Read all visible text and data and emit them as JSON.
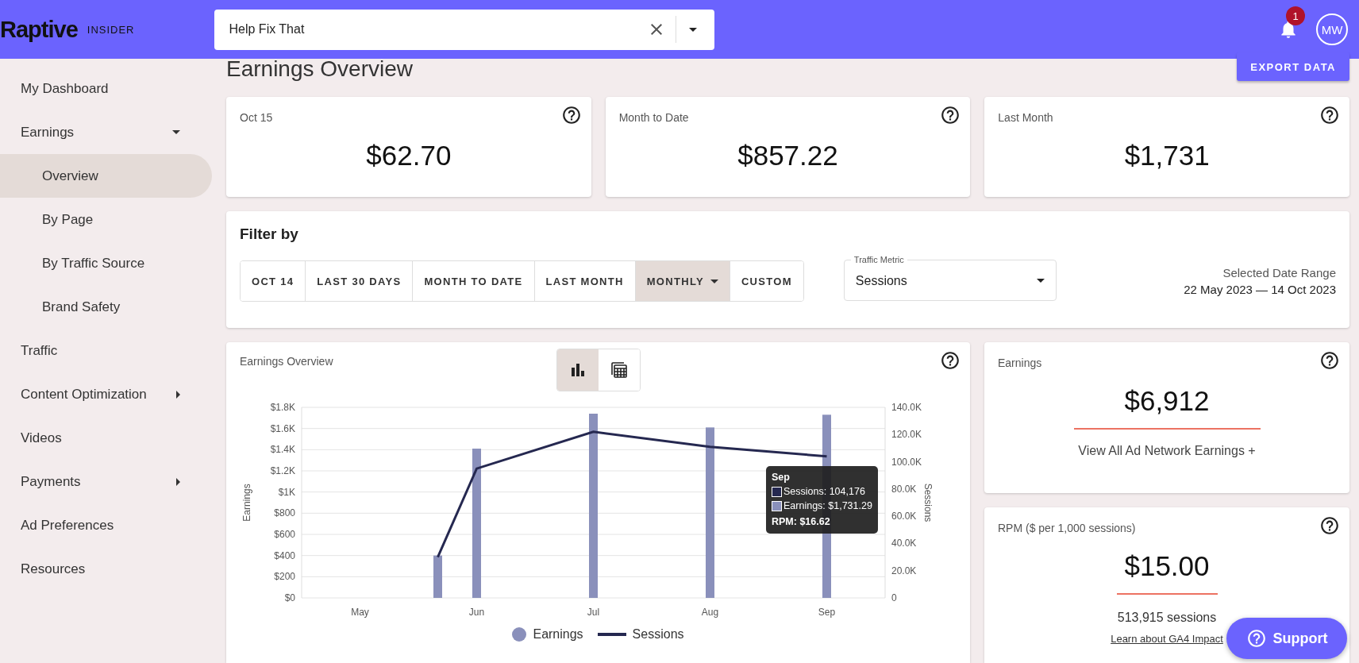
{
  "header": {
    "logo": "Raptive",
    "logo_suffix": "INSIDER",
    "search": {
      "value": "Help Fix That"
    },
    "notifications": {
      "count": "1"
    },
    "avatar": "MW"
  },
  "sidebar": {
    "items": [
      {
        "label": "My Dashboard",
        "selected": false
      },
      {
        "label": "Earnings",
        "selected": false,
        "expanded": true,
        "children": [
          {
            "label": "Overview",
            "selected": true
          },
          {
            "label": "By Page",
            "selected": false
          },
          {
            "label": "By Traffic Source",
            "selected": false
          },
          {
            "label": "Brand Safety",
            "selected": false
          }
        ]
      },
      {
        "label": "Traffic",
        "selected": false
      },
      {
        "label": "Content Optimization",
        "selected": false,
        "expanded": false
      },
      {
        "label": "Videos",
        "selected": false
      },
      {
        "label": "Payments",
        "selected": false,
        "expanded": false
      },
      {
        "label": "Ad Preferences",
        "selected": false
      },
      {
        "label": "Resources",
        "selected": false
      }
    ]
  },
  "page": {
    "title": "Earnings Overview",
    "export_button": "EXPORT DATA"
  },
  "stats": [
    {
      "label": "Oct 15",
      "value": "$62.70"
    },
    {
      "label": "Month to Date",
      "value": "$857.22"
    },
    {
      "label": "Last Month",
      "value": "$1,731"
    }
  ],
  "filter": {
    "title": "Filter by",
    "options": [
      {
        "label": "OCT 14",
        "selected": false
      },
      {
        "label": "LAST 30 DAYS",
        "selected": false
      },
      {
        "label": "MONTH TO DATE",
        "selected": false
      },
      {
        "label": "LAST MONTH",
        "selected": false
      },
      {
        "label": "MONTHLY",
        "selected": true,
        "dropdown": true
      },
      {
        "label": "CUSTOM",
        "selected": false
      }
    ],
    "traffic_metric": {
      "label": "Traffic Metric",
      "value": "Sessions"
    },
    "date_range": {
      "label": "Selected Date Range",
      "value": "22 May 2023 — 14 Oct 2023"
    }
  },
  "chart_panel": {
    "title": "Earnings Overview",
    "view_toggle": [
      {
        "kind": "chart",
        "selected": true
      },
      {
        "kind": "table",
        "selected": false
      }
    ],
    "earnings_layer": {
      "chart_data": {
        "type": "bar",
        "ylabel": "Earnings",
        "grid": true,
        "categories": [
          "May",
          null,
          null,
          "Jun",
          null,
          null,
          "Jul",
          null,
          null,
          "Aug",
          null,
          null,
          "Sep"
        ],
        "ylim": [
          0,
          1800
        ],
        "yticks": [
          {
            "value": 0,
            "label": "$0"
          },
          {
            "value": 200,
            "label": "$200"
          },
          {
            "value": 400,
            "label": "$400"
          },
          {
            "value": 600,
            "label": "$600"
          },
          {
            "value": 800,
            "label": "$800"
          },
          {
            "value": 1000,
            "label": "$1K"
          },
          {
            "value": 1200,
            "label": "$1.2K"
          },
          {
            "value": 1400,
            "label": "$1.4K"
          },
          {
            "value": 1600,
            "label": "$1.6K"
          },
          {
            "value": 1800,
            "label": "$1.8K"
          }
        ],
        "series": [
          {
            "name": "Earnings",
            "color": "#8a90bb",
            "values": [
              null,
              null,
              400,
              1410,
              null,
              null,
              1740,
              null,
              null,
              1610,
              null,
              null,
              1730
            ]
          }
        ]
      }
    },
    "sessions_layer": {
      "chart_data": {
        "type": "line",
        "ylabel": "Sessions",
        "ylim": [
          0,
          140000
        ],
        "yticks": [
          {
            "value": 0,
            "label": "0"
          },
          {
            "value": 20000,
            "label": "20.0K"
          },
          {
            "value": 40000,
            "label": "40.0K"
          },
          {
            "value": 60000,
            "label": "60.0K"
          },
          {
            "value": 80000,
            "label": "80.0K"
          },
          {
            "value": 100000,
            "label": "100.0K"
          },
          {
            "value": 120000,
            "label": "120.0K"
          },
          {
            "value": 140000,
            "label": "140.0K"
          }
        ],
        "series": [
          {
            "name": "Sessions",
            "color": "#252850",
            "values": [
              null,
              null,
              30000,
              95000,
              null,
              null,
              122000,
              null,
              null,
              111000,
              null,
              null,
              104000
            ]
          }
        ]
      }
    },
    "tooltip": {
      "title": "Sep",
      "rows": [
        {
          "label": "Sessions: 104,176",
          "color": "#252850"
        },
        {
          "label": "Earnings: $1,731.29",
          "color": "#8a90bb"
        }
      ],
      "footer": "RPM: $16.62"
    }
  },
  "earnings_card": {
    "title": "Earnings",
    "value": "$6,912",
    "link": "View All Ad Network Earnings +"
  },
  "rpm_card": {
    "title": "RPM ($ per 1,000 sessions)",
    "value": "$15.00",
    "sessions": "513,915 sessions",
    "link": "Learn about GA4 Impact"
  },
  "support_button": "Support"
}
